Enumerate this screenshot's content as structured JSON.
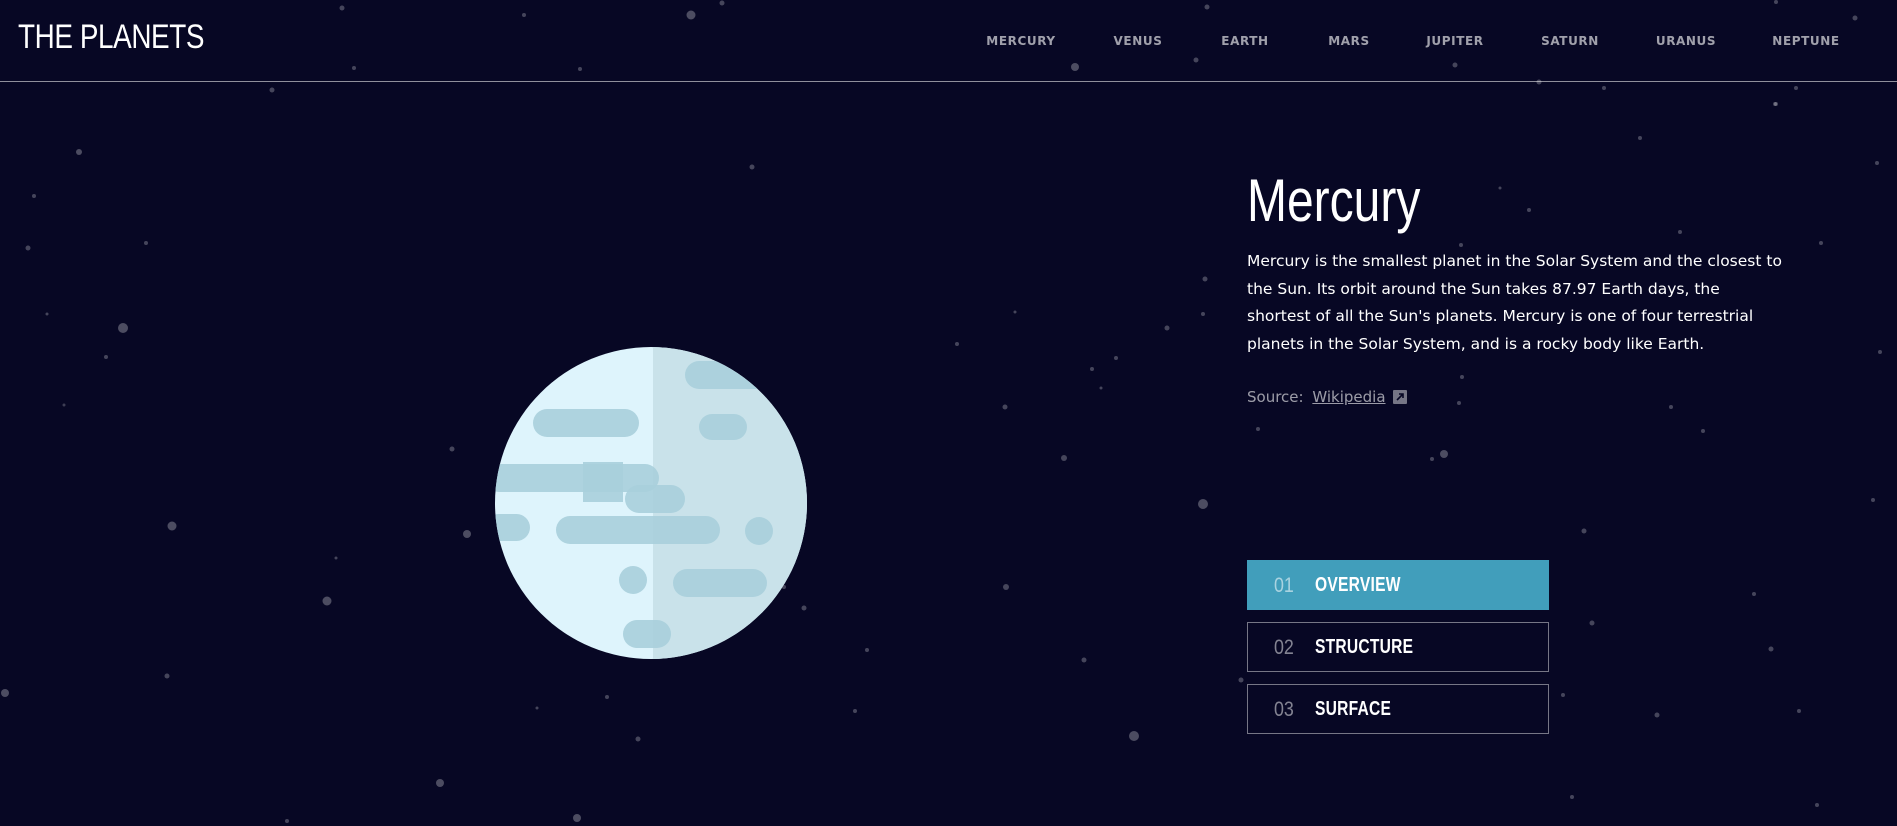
{
  "app": {
    "title": "THE PLANETS"
  },
  "nav": {
    "items": [
      {
        "label": "MERCURY"
      },
      {
        "label": "VENUS"
      },
      {
        "label": "EARTH"
      },
      {
        "label": "MARS"
      },
      {
        "label": "JUPITER"
      },
      {
        "label": "SATURN"
      },
      {
        "label": "URANUS"
      },
      {
        "label": "NEPTUNE"
      }
    ]
  },
  "planet": {
    "name": "Mercury",
    "description": "Mercury is the smallest planet in the Solar System and the closest to the Sun. Its orbit around the Sun takes 87.97 Earth days, the shortest of all the Sun's planets. Mercury is one of four terrestrial planets in the Solar System, and is a rocky body like Earth.",
    "source_label": "Source:",
    "source_link": "Wikipedia",
    "icon": "external-link-icon"
  },
  "tabs": [
    {
      "num": "01",
      "label": "OVERVIEW",
      "active": true
    },
    {
      "num": "02",
      "label": "STRUCTURE",
      "active": false
    },
    {
      "num": "03",
      "label": "SURFACE",
      "active": false
    }
  ],
  "colors": {
    "background": "#070724",
    "accent": "#419ebb",
    "planet_light": "#def4fc",
    "planet_shade": "#c9e2ea",
    "planet_marks": "#a9cfdc"
  }
}
